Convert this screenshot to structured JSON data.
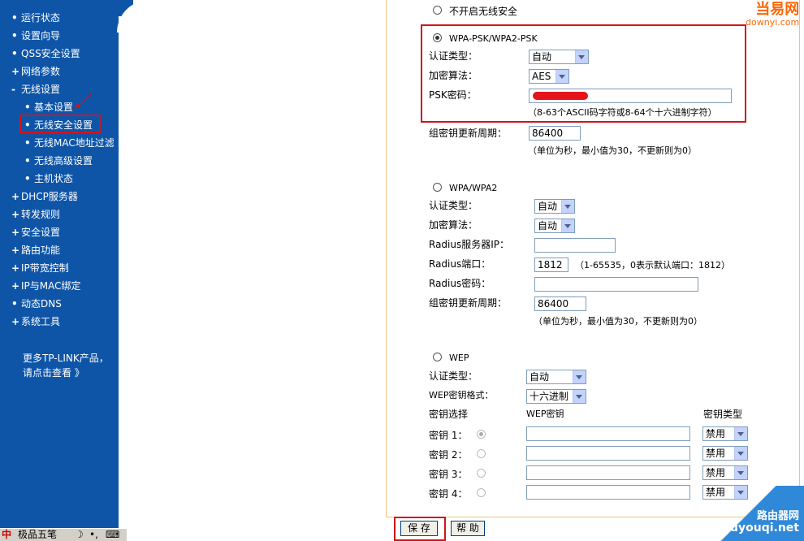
{
  "sidebar": {
    "items": [
      {
        "marker": "•",
        "label": "运行状态"
      },
      {
        "marker": "•",
        "label": "设置向导"
      },
      {
        "marker": "•",
        "label": "QSS安全设置"
      },
      {
        "marker": "+",
        "label": "网络参数"
      },
      {
        "marker": "-",
        "label": "无线设置"
      },
      {
        "marker": "•",
        "label": "基本设置"
      },
      {
        "marker": "•",
        "label": "无线安全设置"
      },
      {
        "marker": "•",
        "label": "无线MAC地址过滤"
      },
      {
        "marker": "•",
        "label": "无线高级设置"
      },
      {
        "marker": "•",
        "label": "主机状态"
      },
      {
        "marker": "+",
        "label": "DHCP服务器"
      },
      {
        "marker": "+",
        "label": "转发规则"
      },
      {
        "marker": "+",
        "label": "安全设置"
      },
      {
        "marker": "+",
        "label": "路由功能"
      },
      {
        "marker": "+",
        "label": "IP带宽控制"
      },
      {
        "marker": "+",
        "label": "IP与MAC绑定"
      },
      {
        "marker": "•",
        "label": "动态DNS"
      },
      {
        "marker": "+",
        "label": "系统工具"
      }
    ],
    "promo_line1": "更多TP-LINK产品，",
    "promo_line2": "请点击查看 》"
  },
  "ime": {
    "label": "极品五笔"
  },
  "none_option": {
    "label": "不开启无线安全"
  },
  "wpa_psk": {
    "title": "WPA-PSK/WPA2-PSK",
    "auth_label": "认证类型：",
    "auth_value": "自动",
    "enc_label": "加密算法：",
    "enc_value": "AES",
    "psk_label": "PSK密码：",
    "psk_hint": "（8-63个ASCII码字符或8-64个十六进制字符）",
    "renew_label": "组密钥更新周期：",
    "renew_value": "86400",
    "renew_hint": "（单位为秒，最小值为30，不更新则为0）"
  },
  "wpa": {
    "title": "WPA/WPA2",
    "auth_label": "认证类型：",
    "auth_value": "自动",
    "enc_label": "加密算法：",
    "enc_value": "自动",
    "ip_label": "Radius服务器IP：",
    "port_label": "Radius端口：",
    "port_value": "1812",
    "port_hint": "（1-65535，0表示默认端口：1812）",
    "pwd_label": "Radius密码：",
    "renew_label": "组密钥更新周期：",
    "renew_value": "86400",
    "renew_hint": "（单位为秒，最小值为30，不更新则为0）"
  },
  "wep": {
    "title": "WEP",
    "auth_label": "认证类型：",
    "auth_value": "自动",
    "format_label": "WEP密钥格式：",
    "format_value": "十六进制",
    "col_select": "密钥选择",
    "col_key": "WEP密钥",
    "col_type": "密钥类型",
    "keys": [
      {
        "label": "密钥 1：",
        "type": "禁用"
      },
      {
        "label": "密钥 2：",
        "type": "禁用"
      },
      {
        "label": "密钥 3：",
        "type": "禁用"
      },
      {
        "label": "密钥 4：",
        "type": "禁用"
      }
    ]
  },
  "buttons": {
    "save": "保 存",
    "help": "帮 助"
  },
  "watermarks": {
    "top_name": "当易网",
    "top_url": "downyi.com",
    "bottom_name": "路由器网",
    "bottom_url": "luyouqi.net"
  },
  "colors": {
    "sidebar": "#0e55a8",
    "highlight": "#d0141c",
    "panel_border": "#f3c27a"
  }
}
